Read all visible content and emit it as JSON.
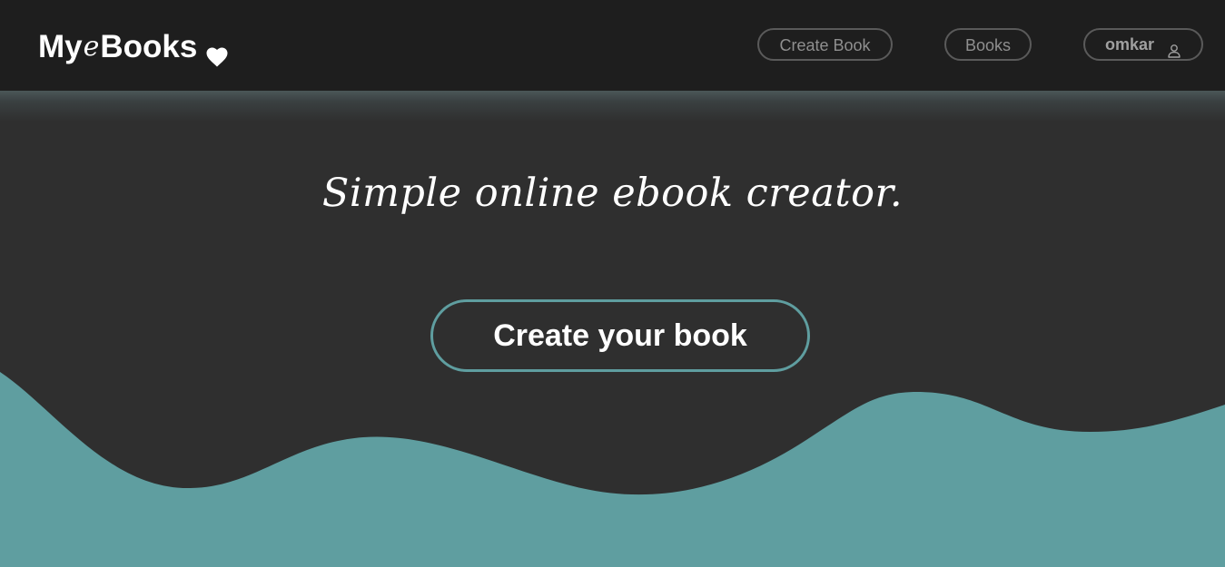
{
  "brand": {
    "prefix": "My",
    "emphasis": "e",
    "suffix": "Books"
  },
  "nav": {
    "create_book_label": "Create Book",
    "books_label": "Books",
    "user_label": "omkar"
  },
  "hero": {
    "tagline": "Simple online ebook creator.",
    "cta_label": "Create your book"
  },
  "icons": {
    "brand_icon": "heart-icon",
    "user_icon": "user-icon"
  },
  "colors": {
    "navbar_bg": "#1e1e1e",
    "hero_bg": "#2f2f2f",
    "accent_teal": "#5f9ea0",
    "text_white": "#ffffff",
    "nav_text": "#8f8f8f"
  }
}
